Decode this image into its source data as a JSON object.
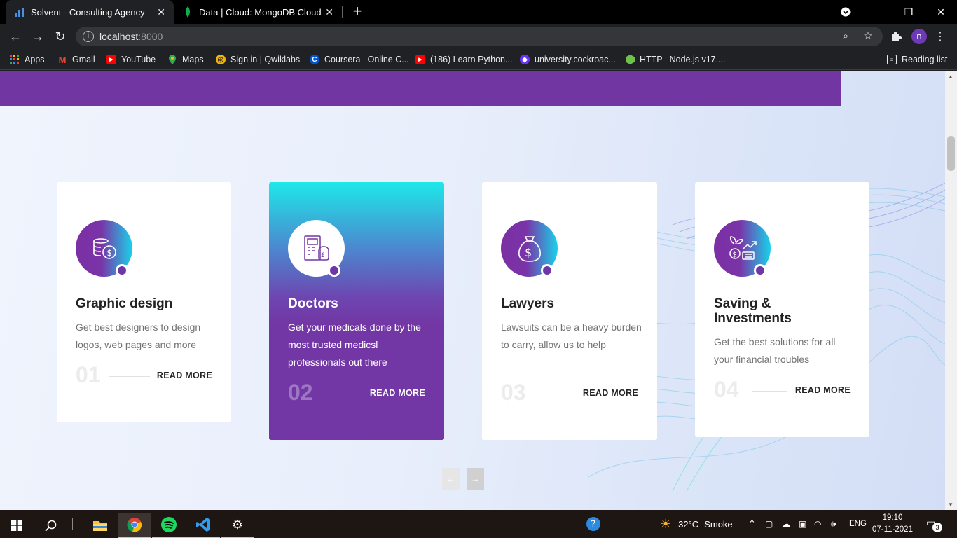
{
  "browser": {
    "tabs": [
      {
        "title": "Solvent - Consulting Agency",
        "active": true,
        "favicon": "bar-chart-icon"
      },
      {
        "title": "Data | Cloud: MongoDB Cloud",
        "active": false,
        "favicon": "mongodb-leaf-icon"
      }
    ],
    "url_host": "localhost",
    "url_port": ":8000",
    "profile_initial": "n",
    "bookmarks": [
      {
        "label": "Apps",
        "icon": "apps-grid-icon"
      },
      {
        "label": "Gmail",
        "icon": "gmail-icon"
      },
      {
        "label": "YouTube",
        "icon": "youtube-icon"
      },
      {
        "label": "Maps",
        "icon": "maps-pin-icon"
      },
      {
        "label": "Sign in | Qwiklabs",
        "icon": "qwiklabs-icon"
      },
      {
        "label": "Coursera | Online C...",
        "icon": "coursera-icon"
      },
      {
        "label": "(186) Learn Python...",
        "icon": "youtube-icon"
      },
      {
        "label": "university.cockroac...",
        "icon": "cockroach-icon"
      },
      {
        "label": "HTTP | Node.js v17....",
        "icon": "nodejs-icon"
      }
    ],
    "reading_list": "Reading list"
  },
  "services": {
    "cards": [
      {
        "title": "Graphic design",
        "desc": "Get best designers to design logos, web pages and more",
        "number": "01",
        "more": "READ MORE",
        "icon": "coins-dollar-icon"
      },
      {
        "title": "Doctors",
        "desc": "Get your medicals done by the most trusted medicsl professionals out there",
        "number": "02",
        "more": "READ MORE",
        "icon": "calculator-money-icon"
      },
      {
        "title": "Lawyers",
        "desc": "Lawsuits can be a heavy burden to carry, allow us to help",
        "number": "03",
        "more": "READ MORE",
        "icon": "money-bag-icon"
      },
      {
        "title": "Saving & Investments",
        "desc": "Get the best solutions for all your financial troubles",
        "number": "04",
        "more": "READ MORE",
        "icon": "growth-investment-icon"
      }
    ],
    "prev_arrow": "←",
    "next_arrow": "→"
  },
  "taskbar": {
    "weather_temp": "32°C",
    "weather_desc": "Smoke",
    "lang": "ENG",
    "time": "19:10",
    "date": "07-11-2021",
    "notif_count": "3"
  },
  "colors": {
    "brand_purple": "#7136a2",
    "accent_cyan": "#18d2ea"
  }
}
